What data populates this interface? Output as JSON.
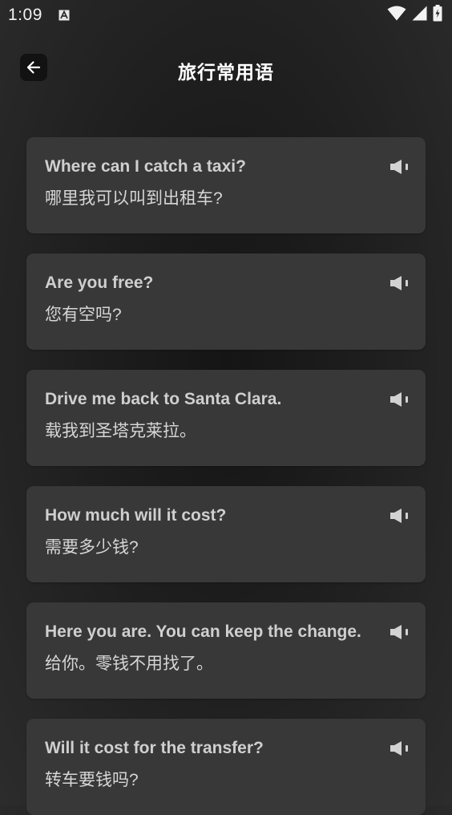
{
  "status_bar": {
    "time": "1:09"
  },
  "header": {
    "title": "旅行常用语"
  },
  "phrases": [
    {
      "en": "Where can I catch a taxi?",
      "zh": "哪里我可以叫到出租车?"
    },
    {
      "en": "Are you free?",
      "zh": "您有空吗?"
    },
    {
      "en": "Drive me back to Santa Clara.",
      "zh": "载我到圣塔克莱拉。"
    },
    {
      "en": "How much will it cost?",
      "zh": "需要多少钱?"
    },
    {
      "en": "Here you are. You can keep the change.",
      "zh": "给你。零钱不用找了。"
    },
    {
      "en": "Will it cost for the transfer?",
      "zh": "转车要钱吗?"
    }
  ],
  "icons": {
    "back": "arrow-left-icon",
    "speaker": "speaker-icon",
    "wifi": "wifi-icon",
    "signal": "signal-icon",
    "battery": "battery-icon"
  }
}
